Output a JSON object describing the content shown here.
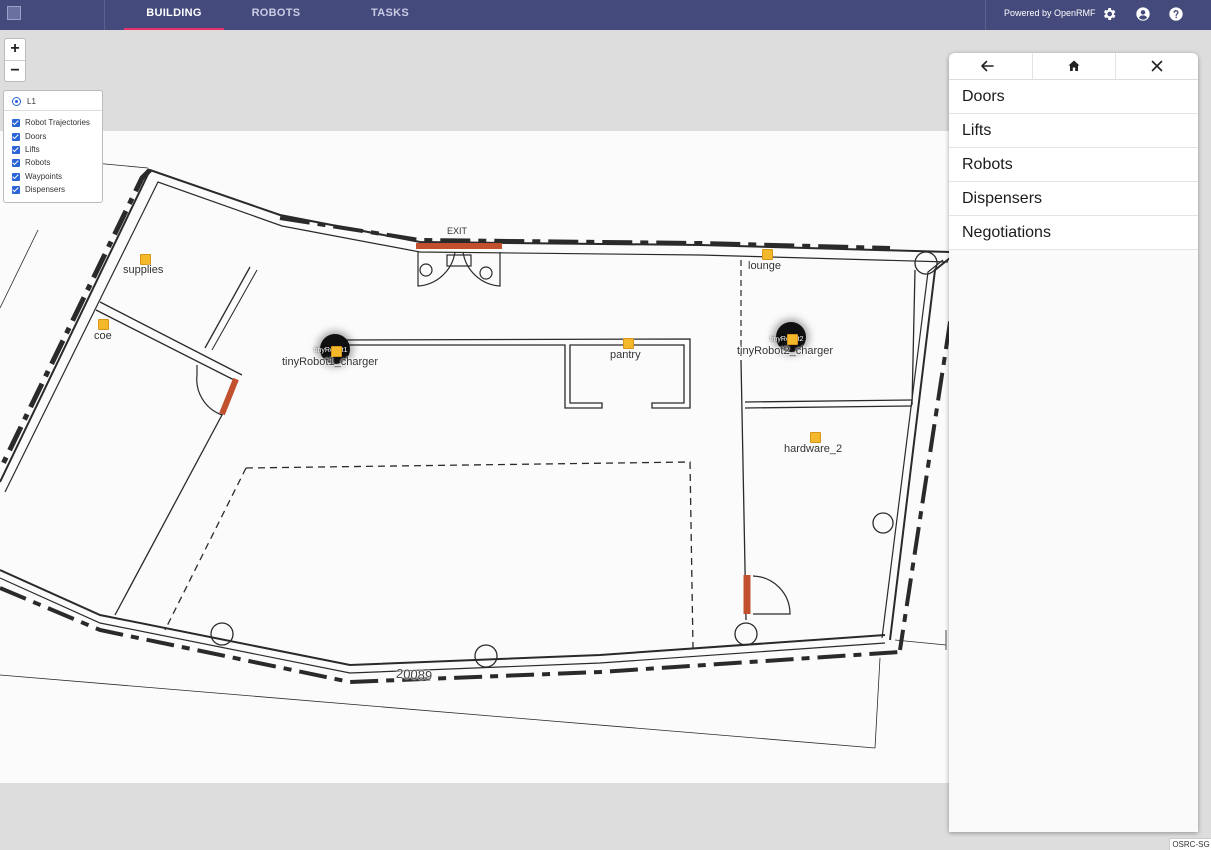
{
  "header": {
    "tabs": [
      {
        "label": "BUILDING",
        "active": true
      },
      {
        "label": "ROBOTS",
        "active": false
      },
      {
        "label": "TASKS",
        "active": false
      }
    ],
    "powered_by": "Powered by OpenRMF",
    "icons": [
      "settings-icon",
      "account-icon",
      "help-icon"
    ],
    "accent_color": "#e8306a",
    "bar_color": "#444a7c"
  },
  "zoom": {
    "in_label": "+",
    "out_label": "−"
  },
  "layers": {
    "level": "L1",
    "items": [
      "Robot Trajectories",
      "Doors",
      "Lifts",
      "Robots",
      "Waypoints",
      "Dispensers"
    ]
  },
  "map": {
    "waypoints": [
      "supplies",
      "coe",
      "tinyRobot1_charger",
      "pantry",
      "lounge",
      "tinyRobot2_charger",
      "hardware_2"
    ],
    "robots": [
      "tinyRobot1",
      "tinyRobot2"
    ],
    "dimension_text": "20089",
    "exit_sign": "EXIT",
    "waypoint_color": "#f4b82b",
    "door_color": "#c1502e"
  },
  "panel": {
    "nav_icons": [
      "back-arrow-icon",
      "home-icon",
      "close-icon"
    ],
    "items": [
      "Doors",
      "Lifts",
      "Robots",
      "Dispensers",
      "Negotiations"
    ]
  },
  "footer": {
    "tag": "OSRC-SG"
  }
}
